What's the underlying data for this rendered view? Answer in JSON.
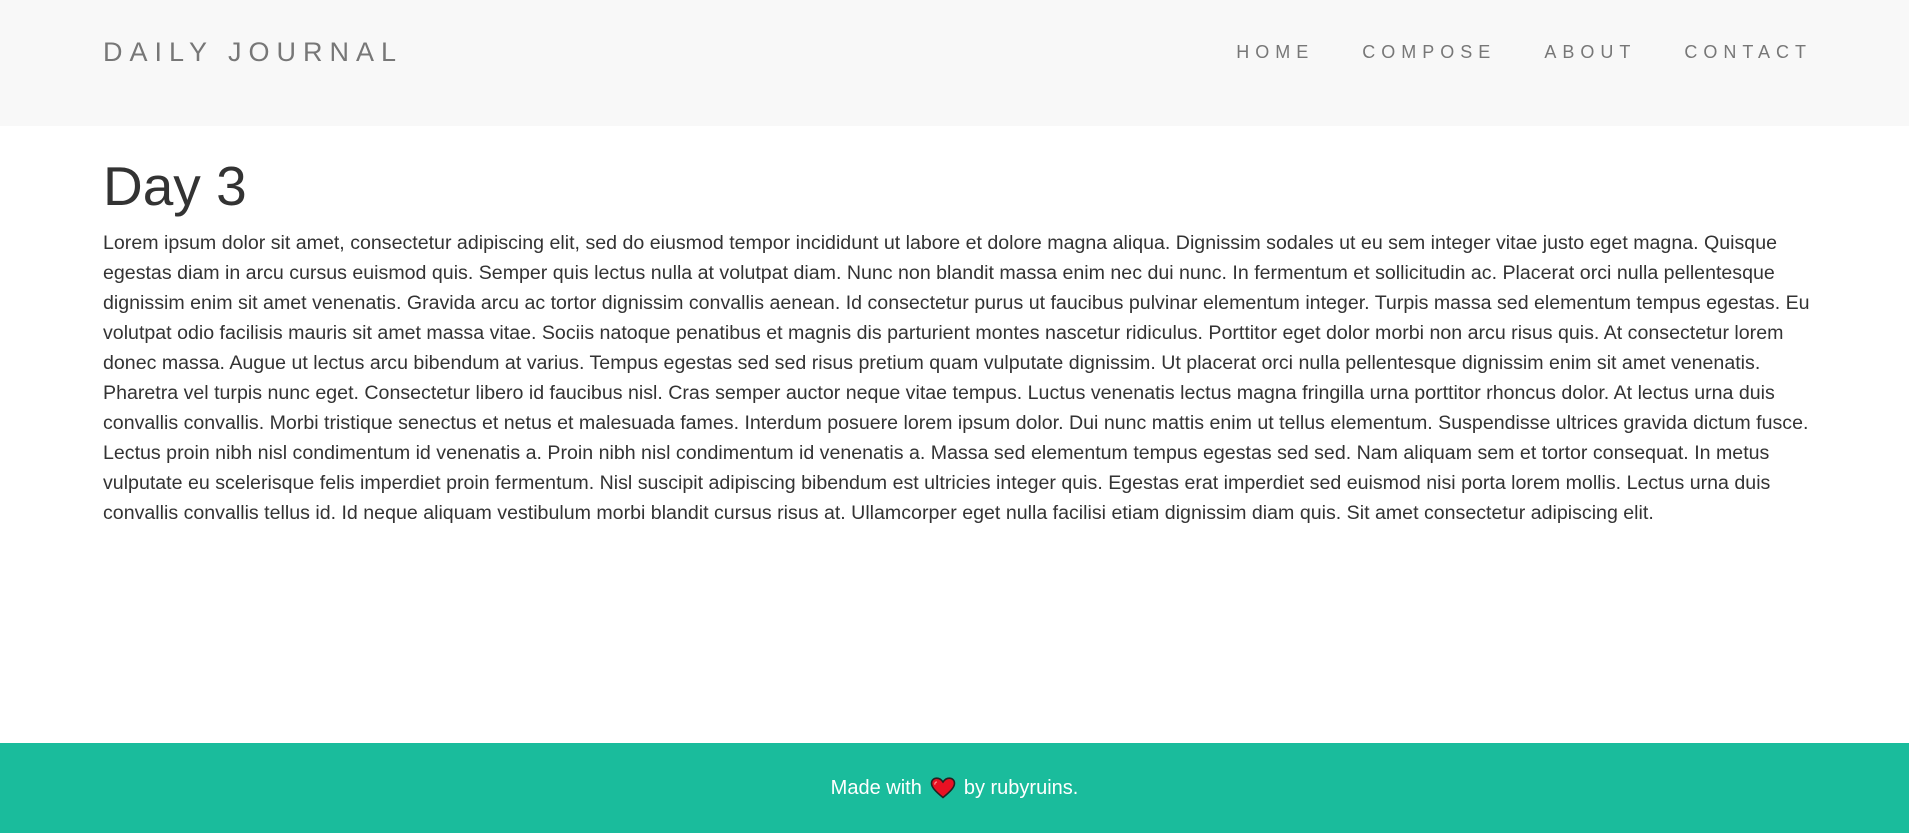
{
  "header": {
    "brand": "DAILY JOURNAL",
    "nav": [
      {
        "label": "HOME"
      },
      {
        "label": "COMPOSE"
      },
      {
        "label": "ABOUT"
      },
      {
        "label": "CONTACT"
      }
    ]
  },
  "post": {
    "title": "Day 3",
    "body": "Lorem ipsum dolor sit amet, consectetur adipiscing elit, sed do eiusmod tempor incididunt ut labore et dolore magna aliqua. Dignissim sodales ut eu sem integer vitae justo eget magna. Quisque egestas diam in arcu cursus euismod quis. Semper quis lectus nulla at volutpat diam. Nunc non blandit massa enim nec dui nunc. In fermentum et sollicitudin ac. Placerat orci nulla pellentesque dignissim enim sit amet venenatis. Gravida arcu ac tortor dignissim convallis aenean. Id consectetur purus ut faucibus pulvinar elementum integer. Turpis massa sed elementum tempus egestas. Eu volutpat odio facilisis mauris sit amet massa vitae. Sociis natoque penatibus et magnis dis parturient montes nascetur ridiculus. Porttitor eget dolor morbi non arcu risus quis. At consectetur lorem donec massa. Augue ut lectus arcu bibendum at varius. Tempus egestas sed sed risus pretium quam vulputate dignissim. Ut placerat orci nulla pellentesque dignissim enim sit amet venenatis. Pharetra vel turpis nunc eget. Consectetur libero id faucibus nisl. Cras semper auctor neque vitae tempus. Luctus venenatis lectus magna fringilla urna porttitor rhoncus dolor. At lectus urna duis convallis convallis. Morbi tristique senectus et netus et malesuada fames. Interdum posuere lorem ipsum dolor. Dui nunc mattis enim ut tellus elementum. Suspendisse ultrices gravida dictum fusce. Lectus proin nibh nisl condimentum id venenatis a. Proin nibh nisl condimentum id venenatis a. Massa sed elementum tempus egestas sed sed. Nam aliquam sem et tortor consequat. In metus vulputate eu scelerisque felis imperdiet proin fermentum. Nisl suscipit adipiscing bibendum est ultricies integer quis. Egestas erat imperdiet sed euismod nisi porta lorem mollis. Lectus urna duis convallis convallis tellus id. Id neque aliquam vestibulum morbi blandit cursus risus at. Ullamcorper eget nulla facilisi etiam dignissim diam quis. Sit amet consectetur adipiscing elit."
  },
  "footer": {
    "prefix": "Made with",
    "icon": "heart-icon",
    "suffix": "by rubyruins."
  },
  "colors": {
    "navbar_bg": "#f8f8f8",
    "footer_bg": "#1abc9c",
    "heart": "#e81123"
  }
}
